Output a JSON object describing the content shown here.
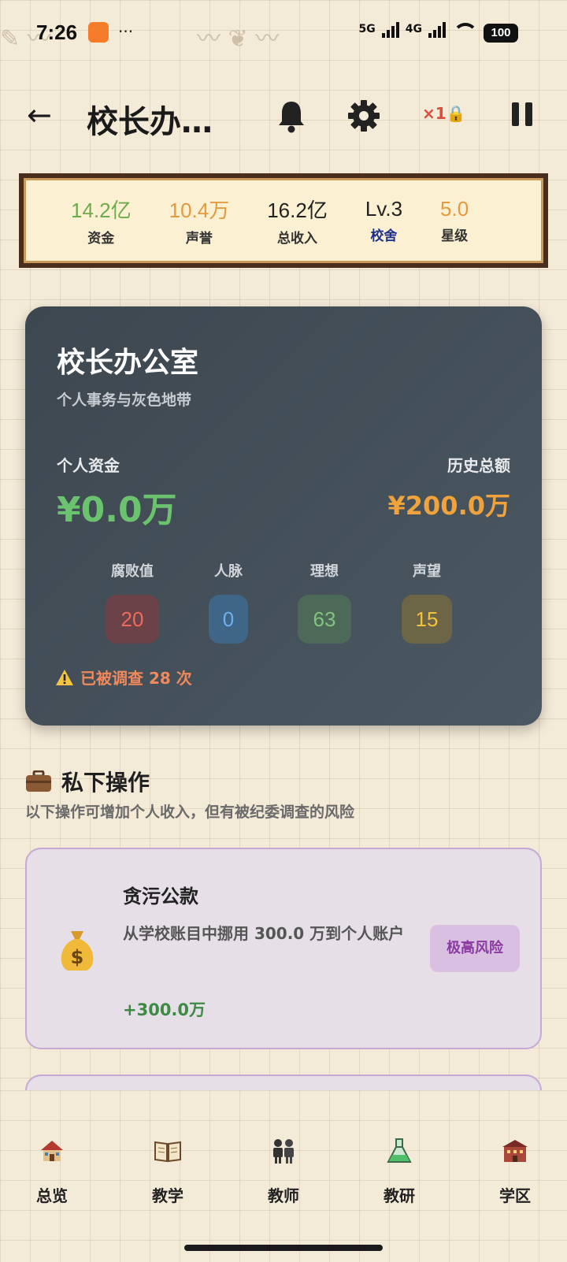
{
  "status": {
    "time": "7:26",
    "dots": "···",
    "net1": "5G",
    "net2": "4G",
    "battery": "100"
  },
  "header": {
    "title": "校长办…",
    "back_label": "←",
    "speed": "×1🔒"
  },
  "stats": [
    {
      "value": "14.2亿",
      "label": "资金",
      "value_color": "#6fab4d",
      "label_color": "#333333"
    },
    {
      "value": "10.4万",
      "label": "声誉",
      "value_color": "#e39a3e",
      "label_color": "#333333"
    },
    {
      "value": "16.2亿",
      "label": "总收入",
      "value_color": "#222222",
      "label_color": "#333333"
    },
    {
      "value": "Lv.3",
      "label": "校舍",
      "value_color": "#222222",
      "label_color": "#1f2f8a"
    },
    {
      "value": "5.0",
      "label": "星级",
      "value_color": "#e39a3e",
      "label_color": "#333333"
    }
  ],
  "office": {
    "title": "校长办公室",
    "subtitle": "个人事务与灰色地带",
    "fund_label": "个人资金",
    "fund_value": "¥0.0万",
    "history_label": "历史总额",
    "history_value": "¥200.0万",
    "metrics": [
      {
        "label": "腐败值",
        "value": "20",
        "bg": "#6c4249",
        "fg": "#ef6a5c"
      },
      {
        "label": "人脉",
        "value": "0",
        "bg": "#3f6587",
        "fg": "#6cb1ef"
      },
      {
        "label": "理想",
        "value": "63",
        "bg": "#4d6a58",
        "fg": "#7fc47f"
      },
      {
        "label": "声望",
        "value": "15",
        "bg": "#6c6646",
        "fg": "#f0c23d"
      }
    ],
    "warning": "已被调查 28 次"
  },
  "private_ops": {
    "title": "私下操作",
    "desc": "以下操作可增加个人收入，但有被纪委调查的风险",
    "items": [
      {
        "title": "贪污公款",
        "desc": "从学校账目中挪用 300.0 万到个人账户",
        "gain": "+300.0万",
        "risk": "极高风险"
      }
    ]
  },
  "nav": [
    {
      "label": "总览",
      "icon": "school-house-icon"
    },
    {
      "label": "教学",
      "icon": "open-book-icon"
    },
    {
      "label": "教师",
      "icon": "teachers-icon"
    },
    {
      "label": "教研",
      "icon": "flask-icon"
    },
    {
      "label": "学区",
      "icon": "campus-building-icon"
    }
  ]
}
